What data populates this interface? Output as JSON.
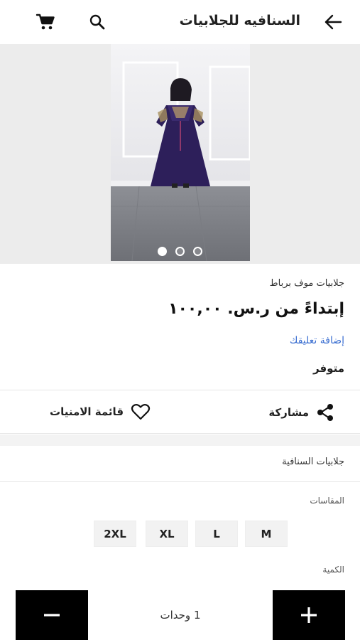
{
  "header": {
    "title": "السنافيه للجلابيات",
    "back_icon": "arrow-left-icon",
    "search_icon": "search-icon",
    "cart_icon": "cart-icon"
  },
  "gallery": {
    "image_count": 3,
    "active_index": 0
  },
  "product": {
    "name": "جلابيات موف برباط",
    "price": "إبتداءً من ر.س. ١٠٠,٠٠",
    "review_link": "إضافة تعليقك",
    "stock_status": "متوفر"
  },
  "actions": {
    "share_label": "مشاركة",
    "wishlist_label": "قائمة الامنيات"
  },
  "brand": {
    "label": "جلابيات السنافية"
  },
  "sizes": {
    "label": "المقاسات",
    "options": [
      "M",
      "L",
      "XL",
      "2XL"
    ]
  },
  "quantity": {
    "label": "الكمية",
    "value_text": "1 وحدات",
    "minus_label": "−",
    "plus_label": "+"
  }
}
